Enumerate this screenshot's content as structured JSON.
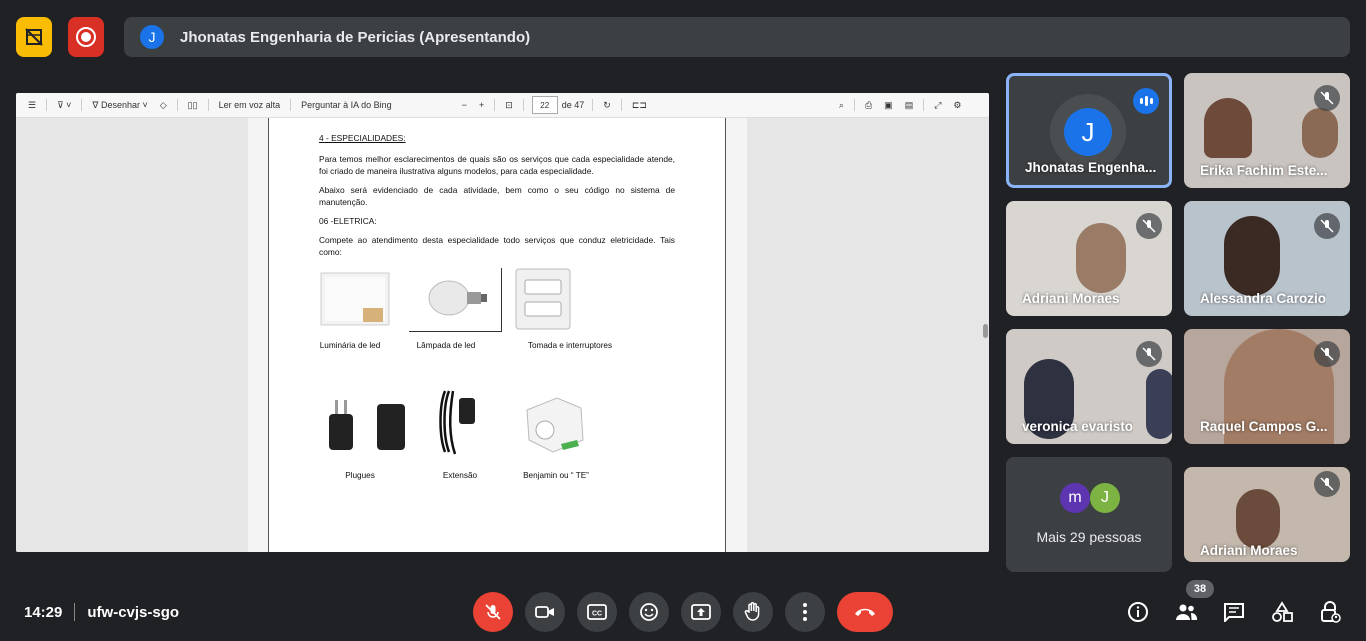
{
  "header": {
    "presenter_initial": "J",
    "presenter_label": "Jhonatas Engenharia de Pericias (Apresentando)"
  },
  "pdf_toolbar": {
    "draw_label": "Desenhar",
    "read_aloud_label": "Ler em voz alta",
    "ask_bing_label": "Perguntar à IA do Bing",
    "page_current": "22",
    "page_total": "de 47"
  },
  "document": {
    "heading": "4 - ESPECIALIDADES:",
    "para1": "Para temos melhor esclarecimentos de quais são os serviços que cada especialidade atende, foi criado de maneira ilustrativa alguns modelos, para cada especialidade.",
    "para2": "Abaixo será evidenciado de cada atividade, bem como o seu código no sistema de manutenção.",
    "section": "06 -ELETRICA:",
    "para3": "Compete ao atendimento desta especialidade todo serviços que conduz eletricidade. Tais como:",
    "captions": [
      "Luminária de led",
      "Lâmpada de led",
      "Tomada  e interruptores",
      "Plugues",
      "Extensão",
      "Benjamin ou “ TE”"
    ]
  },
  "participants": [
    {
      "name": "Jhonatas Engenha...",
      "initial": "J"
    },
    {
      "name": "Erika Fachim Este..."
    },
    {
      "name": "Adriani Moraes"
    },
    {
      "name": "Alessandra Carozio"
    },
    {
      "name": "veronica evaristo"
    },
    {
      "name": "Raquel Campos G..."
    },
    {
      "name": "Mais 29 pessoas",
      "initials": [
        "m",
        "J"
      ]
    },
    {
      "name": "Adriani Moraes"
    }
  ],
  "footer": {
    "time": "14:29",
    "meeting_code": "ufw-cvjs-sgo",
    "people_count": "38"
  },
  "colors": {
    "background": "#202124",
    "accent_blue": "#1a73e8",
    "red": "#ea4335",
    "yellow": "#fbbc04"
  }
}
